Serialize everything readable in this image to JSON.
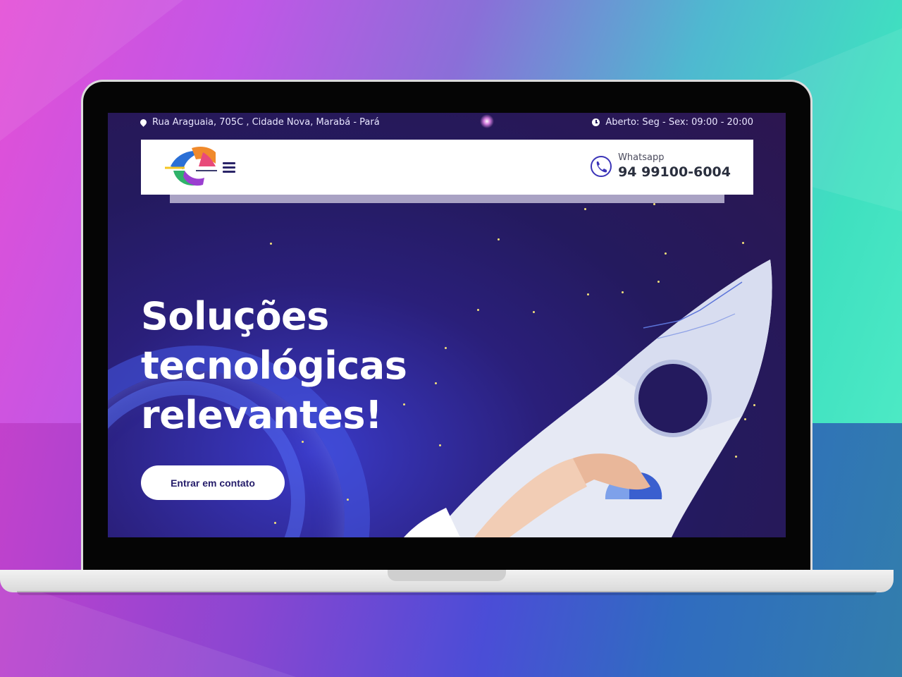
{
  "site": {
    "topbar": {
      "address": "Rua Araguaia, 705C , Cidade Nova, Marabá - Pará",
      "hours": "Aberto: Seg - Sex: 09:00 - 20:00"
    },
    "header": {
      "whatsapp_label": "Whatsapp",
      "whatsapp_number": "94 99100-6004"
    },
    "hero": {
      "line1": "Soluções",
      "line2": "tecnológicas",
      "line3": "relevantes!",
      "cta_label": "Entrar em contato"
    }
  },
  "colors": {
    "hero_bg": "#241a5e",
    "cta_text": "#251d6a",
    "whatsapp_icon": "#3b34b8"
  },
  "icons": {
    "address": "map-pin-icon",
    "hours": "clock-icon",
    "menu": "hamburger-menu-icon",
    "whatsapp": "phone-icon"
  }
}
